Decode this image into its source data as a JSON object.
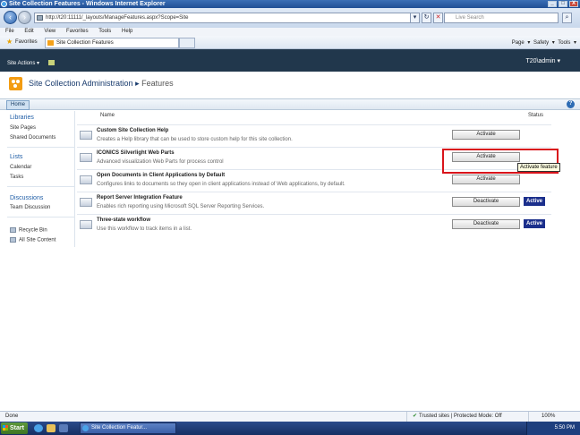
{
  "window": {
    "title": "Site Collection Features - Windows Internet Explorer",
    "minimize": "_",
    "maximize": "□",
    "close": "X"
  },
  "browser": {
    "address": "http://t20:11111/_layouts/ManageFeatures.aspx?Scope=Site",
    "search_placeholder": "Live Search",
    "menu": [
      "File",
      "Edit",
      "View",
      "Favorites",
      "Tools",
      "Help"
    ],
    "favorites_label": "Favorites",
    "tab_title": "Site Collection Features",
    "commands": "Page ▾   Safety ▾   Tools ▾"
  },
  "sharepoint": {
    "site_actions": "Site Actions ▾",
    "user": "T20\\admin ▾",
    "breadcrumb_root": "Site Collection Administration",
    "breadcrumb_sep": "▸",
    "breadcrumb_current": "Features",
    "home_tab": "Home",
    "help": "?"
  },
  "leftnav": {
    "libraries": "Libraries",
    "site_pages": "Site Pages",
    "shared_documents": "Shared Documents",
    "lists": "Lists",
    "calendar": "Calendar",
    "tasks": "Tasks",
    "discussions": "Discussions",
    "team_discussion": "Team Discussion",
    "recycle_bin": "Recycle Bin",
    "all_site_content": "All Site Content"
  },
  "columns": {
    "name": "Name",
    "status": "Status"
  },
  "features": [
    {
      "title": "Custom Site Collection Help",
      "desc": "Creates a Help library that can be used to store custom help for this site collection.",
      "button": "Activate",
      "status": ""
    },
    {
      "title": "ICONICS Silverlight Web Parts",
      "desc": "Advanced visualization Web Parts for process control",
      "button": "Activate",
      "status": ""
    },
    {
      "title": "Open Documents in Client Applications by Default",
      "desc": "Configures links to documents so they open in client applications instead of Web applications, by default.",
      "button": "Activate",
      "status": ""
    },
    {
      "title": "Report Server Integration Feature",
      "desc": "Enables rich reporting using Microsoft SQL Server Reporting Services.",
      "button": "Deactivate",
      "status": "Active"
    },
    {
      "title": "Three-state workflow",
      "desc": "Use this workflow to track items in a list.",
      "button": "Deactivate",
      "status": "Active"
    }
  ],
  "tooltip": "Activate feature",
  "statusbar": {
    "done": "Done",
    "zone": "Trusted sites | Protected Mode: Off",
    "zoom": "100%"
  },
  "taskbar": {
    "start": "Start",
    "task": "Site Collection Featur...",
    "clock": "5:50 PM"
  }
}
